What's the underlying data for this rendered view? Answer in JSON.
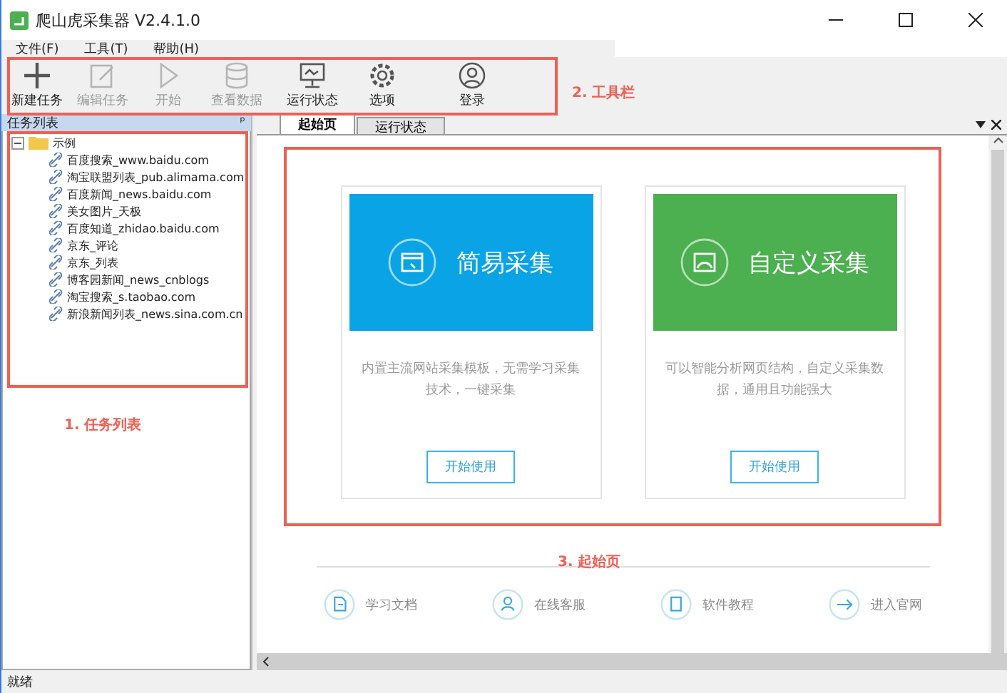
{
  "window": {
    "title": "爬山虎采集器 V2.4.1.0"
  },
  "menu": [
    "文件(F)",
    "工具(T)",
    "帮助(H)"
  ],
  "toolbar": [
    {
      "label": "新建任务",
      "disabled": false
    },
    {
      "label": "编辑任务",
      "disabled": true
    },
    {
      "label": "开始",
      "disabled": true
    },
    {
      "label": "查看数据",
      "disabled": true
    },
    {
      "label": "运行状态",
      "disabled": false
    },
    {
      "label": "选项",
      "disabled": false
    },
    {
      "label": "登录",
      "disabled": false
    }
  ],
  "task_panel": {
    "title": "任务列表",
    "pin": "ᵖ",
    "folder": {
      "label": "示例",
      "expanded": true,
      "children": [
        {
          "label": "百度搜索_www.baidu.com"
        },
        {
          "label": "淘宝联盟列表_pub.alimama.com"
        },
        {
          "label": "百度新闻_news.baidu.com"
        },
        {
          "label": "美女图片_天极"
        },
        {
          "label": "百度知道_zhidao.baidu.com"
        },
        {
          "label": "京东_评论"
        },
        {
          "label": "京东_列表"
        },
        {
          "label": "博客园新闻_news_cnblogs"
        },
        {
          "label": "淘宝搜索_s.taobao.com"
        },
        {
          "label": "新浪新闻列表_news.sina.com.cn"
        }
      ]
    }
  },
  "tabs": [
    {
      "label": "起始页",
      "selected": true
    },
    {
      "label": "运行状态",
      "selected": false
    }
  ],
  "cards": [
    {
      "title": "简易采集",
      "color": "#0aa3e6",
      "description": "内置主流网站采集模板，无需学习采集技术，一键采集",
      "button": "开始使用"
    },
    {
      "title": "自定义采集",
      "color": "#4caf50",
      "description": "可以智能分析网页结构，自定义采集数据，通用且功能强大",
      "button": "开始使用"
    }
  ],
  "links": [
    {
      "label": "学习文档"
    },
    {
      "label": "在线客服"
    },
    {
      "label": "软件教程"
    },
    {
      "label": "进入官网"
    }
  ],
  "annotations": [
    {
      "label": "2. 工具栏"
    },
    {
      "label": "1. 任务列表"
    },
    {
      "label": "3. 起始页"
    }
  ],
  "status_bar": "就绪"
}
